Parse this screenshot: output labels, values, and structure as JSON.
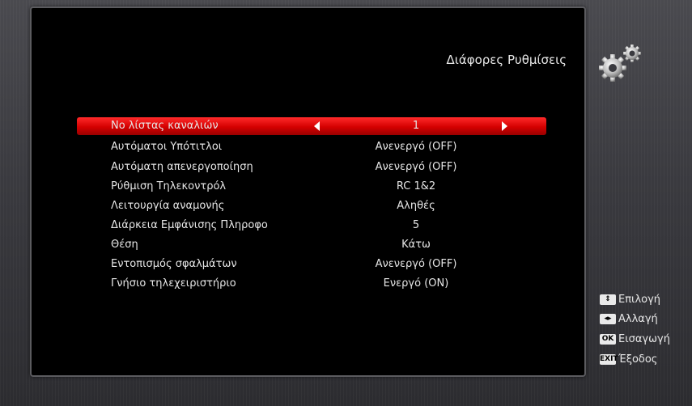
{
  "header": {
    "title": "Διάφορες Ρυθμίσεις",
    "icon": "gears-icon"
  },
  "menu": {
    "items": [
      {
        "label": "Νο λίστας καναλιών",
        "value": "1",
        "selected": true
      },
      {
        "label": "Αυτόματοι Υπότιτλοι",
        "value": "Ανενεργό (OFF)"
      },
      {
        "label": "Αυτόματη απενεργοποίηση",
        "value": "Ανενεργό (OFF)"
      },
      {
        "label": "Ρύθμιση Τηλεκοντρόλ",
        "value": "RC 1&2"
      },
      {
        "label": "Λειτουργία αναμονής",
        "value": "Αληθές"
      },
      {
        "label": "Διάρκεια Εμφάνισης Πληροφο",
        "value": "5"
      },
      {
        "label": "Θέση",
        "value": "Κάτω"
      },
      {
        "label": "Εντοπισμός σφαλμάτων",
        "value": "Ανενεργό (OFF)"
      },
      {
        "label": "Γνήσιο τηλεχειριστήριο",
        "value": "Ενεργό (ON)"
      }
    ]
  },
  "help": {
    "select": {
      "key": "⇕",
      "label": "Επιλογή"
    },
    "change": {
      "key": "◂▸",
      "label": "Αλλαγή"
    },
    "ok": {
      "key": "OK",
      "label": "Εισαγωγή"
    },
    "exit": {
      "key": "EXIT",
      "label": "Έξοδος"
    }
  },
  "colors": {
    "accent": "#d40000",
    "panel": "#000000"
  }
}
